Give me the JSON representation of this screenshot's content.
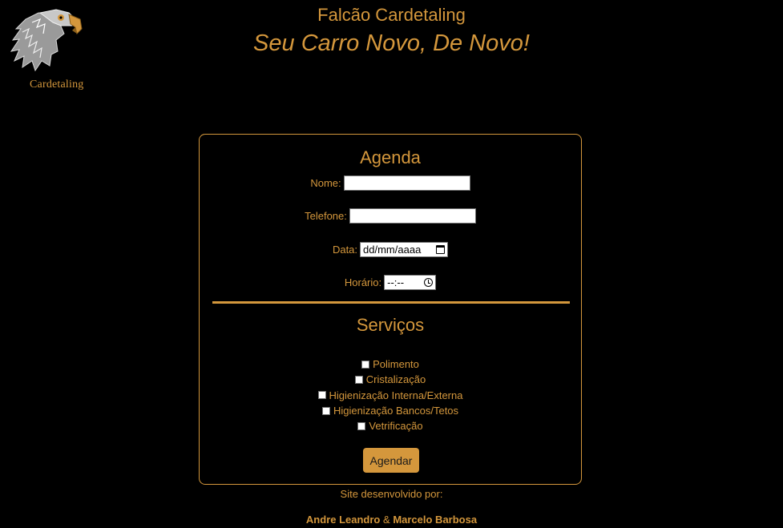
{
  "header": {
    "title": "Falcão Cardetaling",
    "slogan": "Seu Carro Novo, De Novo!",
    "logo_text": "Cardetaling"
  },
  "agenda": {
    "title": "Agenda",
    "fields": {
      "nome_label": "Nome:",
      "telefone_label": "Telefone:",
      "data_label": "Data:",
      "data_placeholder": "dd/mm/aaaa",
      "horario_label": "Horário:",
      "horario_placeholder": "--:--"
    }
  },
  "servicos": {
    "title": "Serviços",
    "items": [
      {
        "label": "Polimento",
        "checked": false
      },
      {
        "label": "Cristalização",
        "checked": false
      },
      {
        "label": "Higienização Interna/Externa",
        "checked": false
      },
      {
        "label": "Higienização Bancos/Tetos",
        "checked": false
      },
      {
        "label": "Vetrificação",
        "checked": false
      }
    ]
  },
  "submit_label": "Agendar",
  "footer": {
    "credit": "Site desenvolvido por:",
    "author1": "Andre Leandro",
    "separator": "&",
    "author2": "Marcelo Barbosa"
  },
  "colors": {
    "accent": "#d4973c",
    "background": "#000000"
  },
  "icons": {
    "logo": "eagle-head-icon",
    "date": "calendar-icon",
    "time": "clock-icon"
  }
}
